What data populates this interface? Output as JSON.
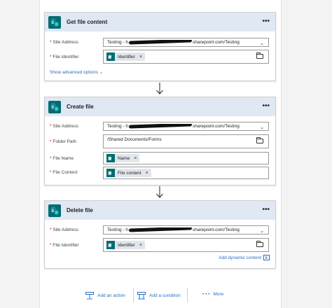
{
  "cards": [
    {
      "title": "Get file content",
      "fields": [
        {
          "label": "Site Address",
          "value_start": "Testing - h",
          "value_end": "sharepoint.com/Testing",
          "kind": "dropdown"
        },
        {
          "label": "File Identifier",
          "token": "Identifier",
          "kind": "folder"
        }
      ],
      "advanced_link": "Show advanced options"
    },
    {
      "title": "Create file",
      "fields": [
        {
          "label": "Site Address",
          "value_start": "Testing - h",
          "value_end": "sharepoint.com/Testing",
          "kind": "dropdown"
        },
        {
          "label": "Folder Path",
          "value": "/Shared Documents/Forms",
          "kind": "folder"
        },
        {
          "label": "File Name",
          "token": "Name",
          "kind": "text"
        },
        {
          "label": "File Content",
          "token": "File content",
          "kind": "text"
        }
      ]
    },
    {
      "title": "Delete file",
      "fields": [
        {
          "label": "Site Address",
          "value_start": "Testing - h",
          "value_end": "sharepoint.com/Testing",
          "kind": "dropdown"
        },
        {
          "label": "File Identifier",
          "token": "Identifier",
          "kind": "folder"
        }
      ],
      "dynamic_link": "Add dynamic content"
    }
  ],
  "required_marker": "*",
  "more_dots": "•••",
  "token_remove": "×",
  "chevron": "⌄",
  "bottom": {
    "add_action": "Add an action",
    "add_condition": "Add a condition",
    "more_dots": "• • •",
    "more": "More"
  },
  "colors": {
    "sharepoint": "#036c70",
    "header": "#dfe8f3",
    "link": "#2b6cc4"
  }
}
